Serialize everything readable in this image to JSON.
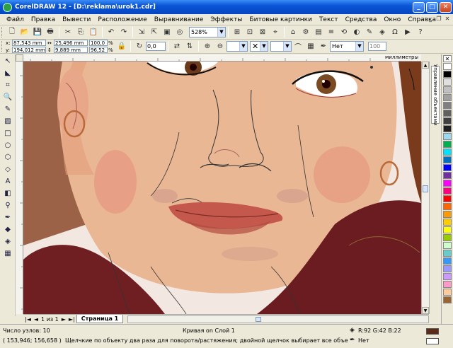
{
  "window": {
    "title": "CorelDRAW 12 - [D:\\reklama\\urok1.cdr]",
    "minimize": "_",
    "maximize": "□",
    "close": "✕"
  },
  "menu": [
    "Файл",
    "Правка",
    "Вывести",
    "Расположение",
    "Выравнивание",
    "Эффекты",
    "Битовые картинки",
    "Текст",
    "Средства",
    "Окно",
    "Справка"
  ],
  "toolbar": {
    "zoom": "528%"
  },
  "property_bar": {
    "x": "87,543 mm",
    "y": "194,012 mm",
    "width": "25,496 mm",
    "height": "9,889 mm",
    "scale_w": "100,0",
    "scale_h": "96,52",
    "pct": "%",
    "angle": "0,0",
    "outline_style": "Нет",
    "smooth": "100"
  },
  "ruler": {
    "unit": "миллиметры"
  },
  "docker": {
    "tab": "Управление объектами"
  },
  "page_nav": {
    "first": "|◄",
    "prev": "◄",
    "page_of": "1 из 1",
    "next": "►",
    "last": "►|",
    "tab": "Страница 1"
  },
  "status": {
    "nodes": "Число узлов: 10",
    "object": "Кривая on Слой 1",
    "coords": "( 153,946; 156,658 )",
    "hint": "Щелчкие по объекту два раза для поворота/растяжения; двойной щелчок выбирает все объекты; Shift+щелчок - выбор не...",
    "fill": "R:92 G:42 B:22",
    "outline": "Нет"
  },
  "colors": {
    "fill_swatch": "#5c2a16",
    "palette": [
      "#ffffff",
      "#000000",
      "#e0e0e0",
      "#c0c0c0",
      "#a0a0a0",
      "#808080",
      "#606060",
      "#404040",
      "#202020",
      "#9ad9ef",
      "#00b050",
      "#00e0ff",
      "#0070c0",
      "#0000ff",
      "#7030a0",
      "#ff00ff",
      "#ff0080",
      "#ff0000",
      "#ff6600",
      "#ff9900",
      "#ffcc00",
      "#ffff00",
      "#99cc00",
      "#ccffcc",
      "#66cccc",
      "#3399ff",
      "#9999ff",
      "#cc99ff",
      "#ff99cc",
      "#ffcc99",
      "#996633",
      "#663300",
      "#333399"
    ]
  }
}
